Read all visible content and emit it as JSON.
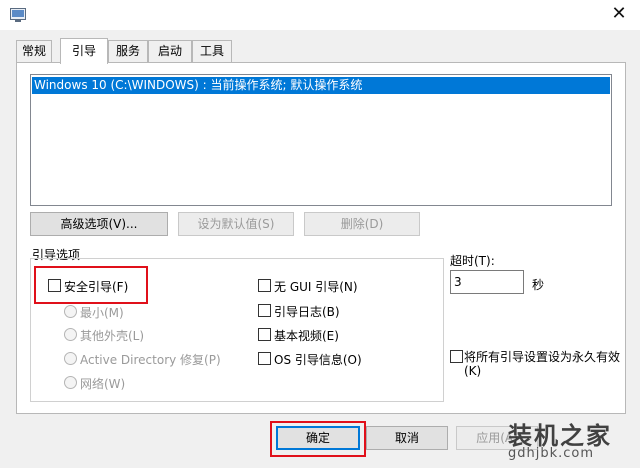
{
  "window": {
    "close_glyph": "✕",
    "icon": "msconfig-icon"
  },
  "tabs": [
    {
      "label": "常规"
    },
    {
      "label": "引导"
    },
    {
      "label": "服务"
    },
    {
      "label": "启动"
    },
    {
      "label": "工具"
    }
  ],
  "active_tab": "引导",
  "os_list": {
    "items": [
      "Windows 10 (C:\\WINDOWS) : 当前操作系统; 默认操作系统"
    ],
    "selected_index": 0
  },
  "buttons": {
    "advanced": "高级选项(V)...",
    "set_default": "设为默认值(S)",
    "delete": "删除(D)"
  },
  "boot_options": {
    "group_label": "引导选项",
    "safe_boot": "安全引导(F)",
    "minimal": "最小(M)",
    "alternate_shell": "其他外壳(L)",
    "active_directory": "Active Directory 修复(P)",
    "network": "网络(W)",
    "no_gui_boot": "无 GUI 引导(N)",
    "boot_log": "引导日志(B)",
    "base_video": "基本视频(E)",
    "os_boot_info": "OS 引导信息(O)"
  },
  "timeout": {
    "label": "超时(T):",
    "value": "3",
    "unit": "秒"
  },
  "make_permanent": {
    "line1": "将所有引导设置设为永久有效",
    "line2": "(K)"
  },
  "dialog_buttons": {
    "ok": "确定",
    "cancel": "取消",
    "apply": "应用(A)"
  },
  "watermark": {
    "title": "装机之家",
    "url": "gdhjbk.com"
  },
  "colors": {
    "selection": "#0078d7",
    "highlight_box": "#e0101a"
  }
}
